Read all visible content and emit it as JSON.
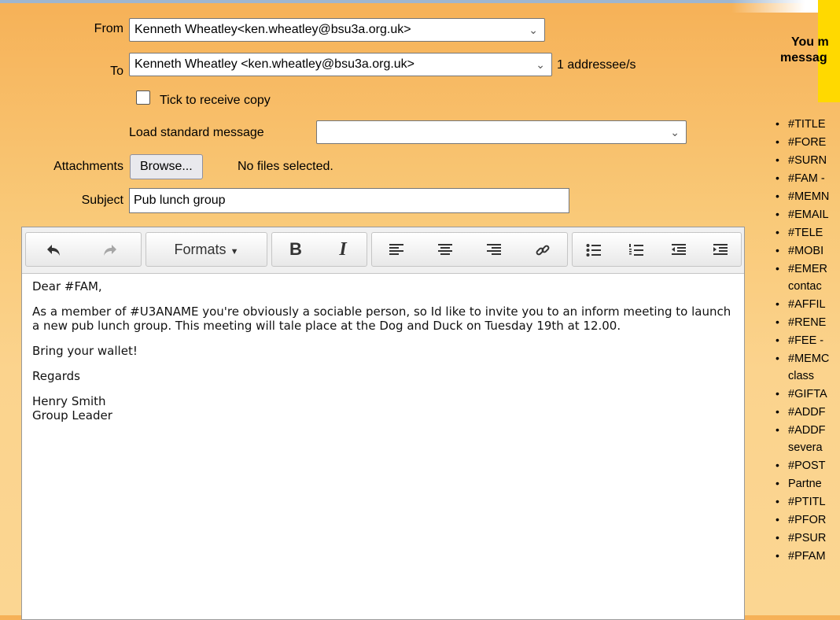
{
  "form": {
    "from_label": "From",
    "from_value": "Kenneth Wheatley<ken.wheatley@bsu3a.org.uk>",
    "to_label": "To",
    "to_value": "Kenneth Wheatley <ken.wheatley@bsu3a.org.uk>",
    "addressee_count": "1 addressee/s",
    "copy_label": "Tick to receive copy",
    "load_label": "Load standard message",
    "load_value": "",
    "attachments_label": "Attachments",
    "browse_label": "Browse...",
    "no_files": "No files selected.",
    "subject_label": "Subject",
    "subject_value": "Pub lunch group"
  },
  "toolbar": {
    "formats_label": "Formats"
  },
  "message": {
    "greeting": "Dear #FAM,",
    "body": "As a member of #U3ANAME you're obviously a sociable person, so Id like to invite you to an inform meeting to launch a new pub lunch group. This meeting will tale place at the Dog and Duck on Tuesday 19th at 12.00.",
    "line3": "Bring your wallet!",
    "regards": "Regards",
    "name": "Henry Smith",
    "role": "Group Leader"
  },
  "sidebar": {
    "title_line1": "You m",
    "title_line2": "messag",
    "codes": [
      "#TITLE",
      "#FORE",
      "#SURN",
      "#FAM -",
      "#MEMN",
      "#EMAIL",
      "#TELE",
      "#MOBI",
      "#EMER",
      "contac",
      "#AFFIL",
      "#RENE",
      "#FEE -",
      "#MEMC",
      "class",
      "#GIFTA",
      "#ADDF",
      "#ADDF",
      "severa",
      "#POST",
      "Partne",
      "#PTITL",
      "#PFOR",
      "#PSUR",
      "#PFAM"
    ]
  }
}
